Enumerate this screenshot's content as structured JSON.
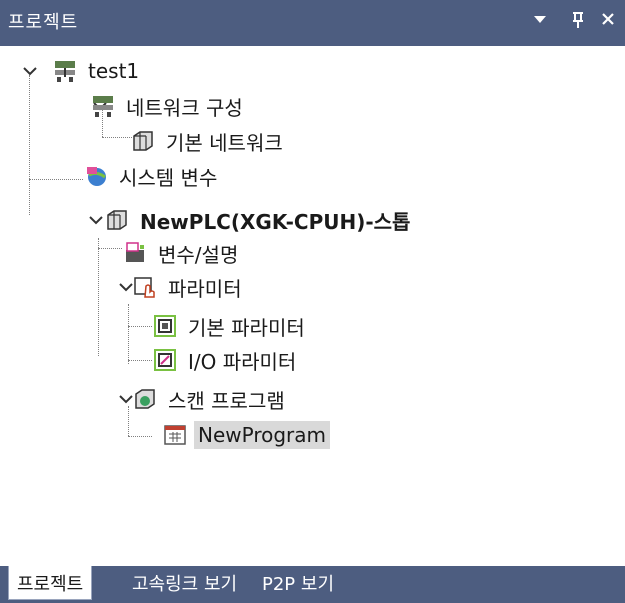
{
  "panel": {
    "title": "프로젝트",
    "dropdown_icon": "triangle-down-icon",
    "pin_icon": "pin-icon",
    "close_icon": "close-icon",
    "header_color": "#4d5d80"
  },
  "tree": {
    "root": "test1",
    "network_config": "네트워크 구성",
    "basic_network": "기본 네트워크",
    "system_vars": "시스템 변수",
    "plc": "NewPLC(XGK-CPUH)-스톱",
    "vars_desc": "변수/설명",
    "parameters": "파라미터",
    "basic_params": "기본 파라미터",
    "io_params": "I/O 파라미터",
    "scan_program": "스캔 프로그램",
    "new_program": "NewProgram"
  },
  "tabs": [
    "프로젝트",
    "고속링크 보기",
    "P2P 보기"
  ]
}
